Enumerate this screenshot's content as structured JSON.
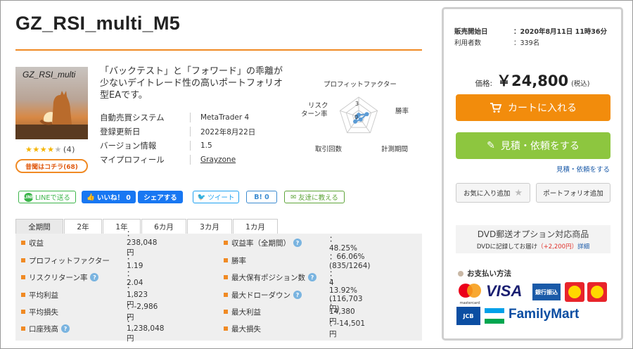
{
  "product": {
    "title": "GZ_RSI_multi_M5",
    "thumb_title": "GZ_RSI_multi",
    "rating": {
      "filled": 4,
      "total": 5,
      "count_text": "(4)"
    },
    "review_button": "昔聞はコチラ(68)",
    "description": "「バックテスト」と「フォワード」の乖離が少ないデイトレード性の高いポートフォリオ型EAです。",
    "info": [
      {
        "key": "自動売買システム",
        "value": "MetaTrader 4"
      },
      {
        "key": "登録更新日",
        "value": "2022年8月22日"
      },
      {
        "key": "バージョン情報",
        "value": "1.5"
      },
      {
        "key": "マイプロフィール",
        "value": "Grayzone"
      }
    ]
  },
  "radar": {
    "labels": [
      "プロフィットファクター",
      "勝率",
      "計測期間",
      "取引回数",
      "リスク\nターン率"
    ],
    "label_lines": {
      "pf": "プロフィットファクター",
      "win": "勝率",
      "period": "計測期間",
      "trades": "取引回数",
      "risk1": "リスク",
      "risk2": "ターン率"
    },
    "ticks": {
      "max": "3",
      "zero": "0"
    },
    "values": [
      0.3,
      1.3,
      0.5,
      0.9,
      0.2
    ],
    "max": 3,
    "colors": {
      "line": "#5b9bd5",
      "grid": "#cccccc"
    }
  },
  "social": {
    "line": "LINEで送る",
    "line_badge": "LINE",
    "like": "いいね！ 0",
    "share": "シェアする",
    "tweet": "ツイート",
    "hatena": "B! 0",
    "friend": "友達に教える"
  },
  "tabs": [
    "全期間",
    "2年",
    "1年",
    "6カ月",
    "3カ月",
    "1カ月"
  ],
  "stats": {
    "left": [
      {
        "key": "収益",
        "value": "：238,048円",
        "help": false
      },
      {
        "key": "プロフィットファクター",
        "value": "：1.19",
        "help": false
      },
      {
        "key": "リスクリターン率",
        "value": "：2.04",
        "help": true
      },
      {
        "key": "平均利益",
        "value": "：1,823円",
        "help": false
      },
      {
        "key": "平均損失",
        "value": "：-2,986円",
        "help": false
      },
      {
        "key": "口座残高",
        "value": "：1,238,048円",
        "help": true
      }
    ],
    "right": [
      {
        "key": "収益率（全期間）",
        "value": "：48.25%",
        "help": true
      },
      {
        "key": "勝率",
        "value": "：66.06% (835/1264)",
        "help": false
      },
      {
        "key": "最大保有ポジション数",
        "value": "：4",
        "help": true
      },
      {
        "key": "最大ドローダウン",
        "value": "：13.92% (116,703円)",
        "help": true
      },
      {
        "key": "最大利益",
        "value": "：14,380円",
        "help": false
      },
      {
        "key": "最大損失",
        "value": "：-14,501円",
        "help": false
      }
    ],
    "help_glyph": "?"
  },
  "side": {
    "sale_start_label": "販売開始日",
    "sale_start_value": "：2020年8月11日 11時36分",
    "users_label": "利用者数",
    "users_value": "：339名",
    "price_label": "価格:",
    "price_value": "￥24,800",
    "price_tax": "(税込)",
    "cart_button": "カートに入れる",
    "quote_button": "見積・依頼をする",
    "quote_link": "見積・依頼をする",
    "fav_button": "お気に入り追加",
    "portfolio_button": "ポートフォリオ追加",
    "dvd_title": "DVD郵送オプション対応商品",
    "dvd_note": "DVDに記録してお届け",
    "dvd_price": "（+2,200円）",
    "dvd_link": "詳細",
    "payment_title": "お支払い方法",
    "payment": {
      "mastercard": "mastercard",
      "visa": "VISA",
      "bank": "銀行振込",
      "jcb": "JCB",
      "familymart": "FamilyMart"
    }
  }
}
